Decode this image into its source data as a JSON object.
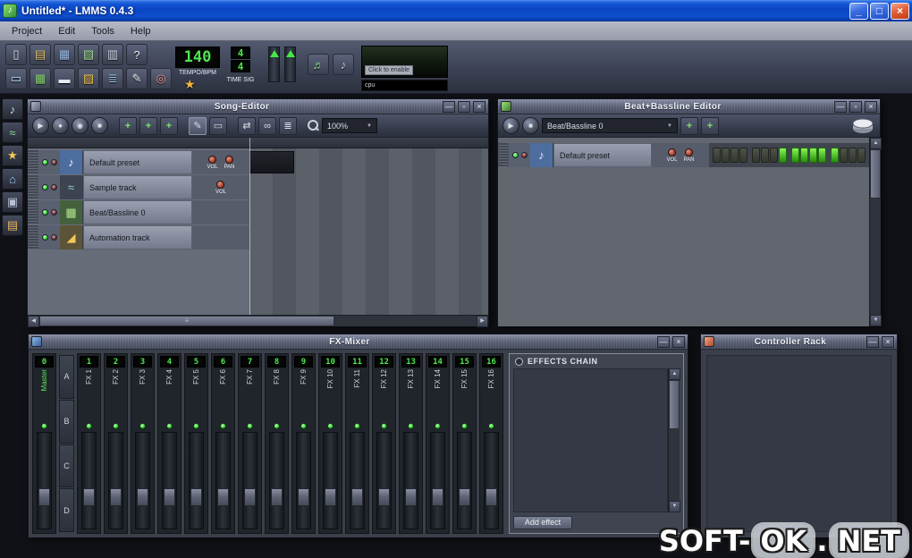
{
  "titlebar": {
    "title": "Untitled* - LMMS 0.4.3"
  },
  "menubar": {
    "items": [
      "Project",
      "Edit",
      "Tools",
      "Help"
    ]
  },
  "main_toolbar": {
    "row1": [
      {
        "name": "new-project-icon",
        "glyph": "▯",
        "fg": "#eef1f7"
      },
      {
        "name": "open-project-icon",
        "glyph": "▤",
        "fg": "#e8c878"
      },
      {
        "name": "save-project-icon",
        "glyph": "▦",
        "fg": "#9fc3ef"
      },
      {
        "name": "export-project-icon",
        "glyph": "▧",
        "fg": "#a9e0a0"
      },
      {
        "name": "project-properties-icon",
        "glyph": "▥",
        "fg": "#d8dce8"
      },
      {
        "name": "whats-this-icon",
        "glyph": "?",
        "fg": "#eef1f7"
      }
    ],
    "row2": [
      {
        "name": "toggle-song-editor-icon",
        "glyph": "▭",
        "fg": "#b8e0f2"
      },
      {
        "name": "toggle-bb-editor-icon",
        "glyph": "▦",
        "fg": "#8fdc78"
      },
      {
        "name": "toggle-piano-roll-icon",
        "glyph": "▬",
        "fg": "#e6e9f2"
      },
      {
        "name": "toggle-automation-editor-icon",
        "glyph": "▨",
        "fg": "#f2c85a"
      },
      {
        "name": "toggle-fx-mixer-icon",
        "glyph": "≣",
        "fg": "#9fd0e8"
      },
      {
        "name": "toggle-project-notes-icon",
        "glyph": "✎",
        "fg": "#e8ebf2"
      },
      {
        "name": "toggle-controller-rack-icon",
        "glyph": "◎",
        "fg": "#f2948a"
      }
    ],
    "tempo": {
      "value": "140",
      "label": "TEMPO/BPM"
    },
    "timesig": {
      "numerator": "4",
      "denominator": "4",
      "label": "TIME SIG"
    },
    "viz_label": "Click to enable",
    "cpu_label": "cpu"
  },
  "toolbox": [
    {
      "name": "instruments-tab-icon",
      "glyph": "♪",
      "fg": "#cfd8ea"
    },
    {
      "name": "samples-tab-icon",
      "glyph": "≈",
      "fg": "#8fd8a0"
    },
    {
      "name": "presets-tab-icon",
      "glyph": "★",
      "fg": "#f2c85a"
    },
    {
      "name": "home-tab-icon",
      "glyph": "⌂",
      "fg": "#9ecbf2"
    },
    {
      "name": "computer-tab-icon",
      "glyph": "▣",
      "fg": "#b8c2d8"
    },
    {
      "name": "folder-tab-icon",
      "glyph": "▤",
      "fg": "#e8b860"
    }
  ],
  "song_editor": {
    "title": "Song-Editor",
    "transport": [
      {
        "name": "play-button",
        "glyph": "▶"
      },
      {
        "name": "record-button",
        "glyph": "●"
      },
      {
        "name": "record-play-button",
        "glyph": "◉"
      },
      {
        "name": "stop-button",
        "glyph": "■"
      }
    ],
    "add_buttons": [
      {
        "name": "add-bb-track-button"
      },
      {
        "name": "add-sample-track-button"
      },
      {
        "name": "add-automation-track-button"
      }
    ],
    "mode_buttons": [
      {
        "name": "draw-mode-button",
        "glyph": "✎",
        "active": true
      },
      {
        "name": "edit-mode-button",
        "glyph": "▭",
        "active": false
      }
    ],
    "misc_buttons": [
      {
        "name": "autoscroll-button",
        "glyph": "⇄"
      },
      {
        "name": "loop-button",
        "glyph": "∞"
      },
      {
        "name": "stop-behaviour-button",
        "glyph": "≣"
      }
    ],
    "zoom_value": "100%",
    "tracks": [
      {
        "name": "Default preset",
        "icon_glyph": "♪",
        "icon_bg": "#4d6d9e",
        "icon_fg": "#e8f0fa",
        "knobs": [
          "VOL",
          "PAN"
        ],
        "pattern": true
      },
      {
        "name": "Sample track",
        "icon_glyph": "≈",
        "icon_bg": "#3d4350",
        "icon_fg": "#8fd8c8",
        "knobs": [
          "VOL"
        ],
        "pattern": false
      },
      {
        "name": "Beat/Bassline 0",
        "icon_glyph": "▦",
        "icon_bg": "#44603c",
        "icon_fg": "#b2e88e",
        "knobs": [],
        "pattern": false
      },
      {
        "name": "Automation track",
        "icon_glyph": "◢",
        "icon_bg": "#5c5338",
        "icon_fg": "#f2c85a",
        "knobs": [],
        "pattern": false
      }
    ]
  },
  "bb_editor": {
    "title": "Beat+Bassline Editor",
    "transport": [
      {
        "name": "play-button",
        "glyph": "▶"
      },
      {
        "name": "stop-button",
        "glyph": "■"
      }
    ],
    "pattern_select": "Beat/Bassline 0",
    "add_buttons": [
      {
        "name": "add-bb-track-button"
      },
      {
        "name": "add-automation-track-button"
      }
    ],
    "track": {
      "name": "Default preset",
      "icon_glyph": "♪",
      "icon_bg": "#4d6d9e",
      "icon_fg": "#e8f0fa",
      "knobs": [
        "VOL",
        "PAN"
      ]
    },
    "steps": [
      0,
      0,
      0,
      0,
      0,
      0,
      0,
      1,
      1,
      1,
      1,
      1,
      1,
      0,
      0,
      0
    ]
  },
  "fx_mixer": {
    "title": "FX-Mixer",
    "bank_letters": [
      "A",
      "B",
      "C",
      "D"
    ],
    "channels": [
      {
        "num": "0",
        "label": "Master"
      },
      {
        "num": "1",
        "label": "FX 1"
      },
      {
        "num": "2",
        "label": "FX 2"
      },
      {
        "num": "3",
        "label": "FX 3"
      },
      {
        "num": "4",
        "label": "FX 4"
      },
      {
        "num": "5",
        "label": "FX 5"
      },
      {
        "num": "6",
        "label": "FX 6"
      },
      {
        "num": "7",
        "label": "FX 7"
      },
      {
        "num": "8",
        "label": "FX 8"
      },
      {
        "num": "9",
        "label": "FX 9"
      },
      {
        "num": "10",
        "label": "FX 10"
      },
      {
        "num": "11",
        "label": "FX 11"
      },
      {
        "num": "12",
        "label": "FX 12"
      },
      {
        "num": "13",
        "label": "FX 13"
      },
      {
        "num": "14",
        "label": "FX 14"
      },
      {
        "num": "15",
        "label": "FX 15"
      },
      {
        "num": "16",
        "label": "FX 16"
      }
    ],
    "effects_chain_title": "EFFECTS CHAIN",
    "add_effect_label": "Add effect"
  },
  "controller_rack": {
    "title": "Controller Rack"
  },
  "watermark": {
    "prefix": "SOFT-",
    "boxed1": "OK",
    "dot": ".",
    "boxed2": "NET"
  }
}
